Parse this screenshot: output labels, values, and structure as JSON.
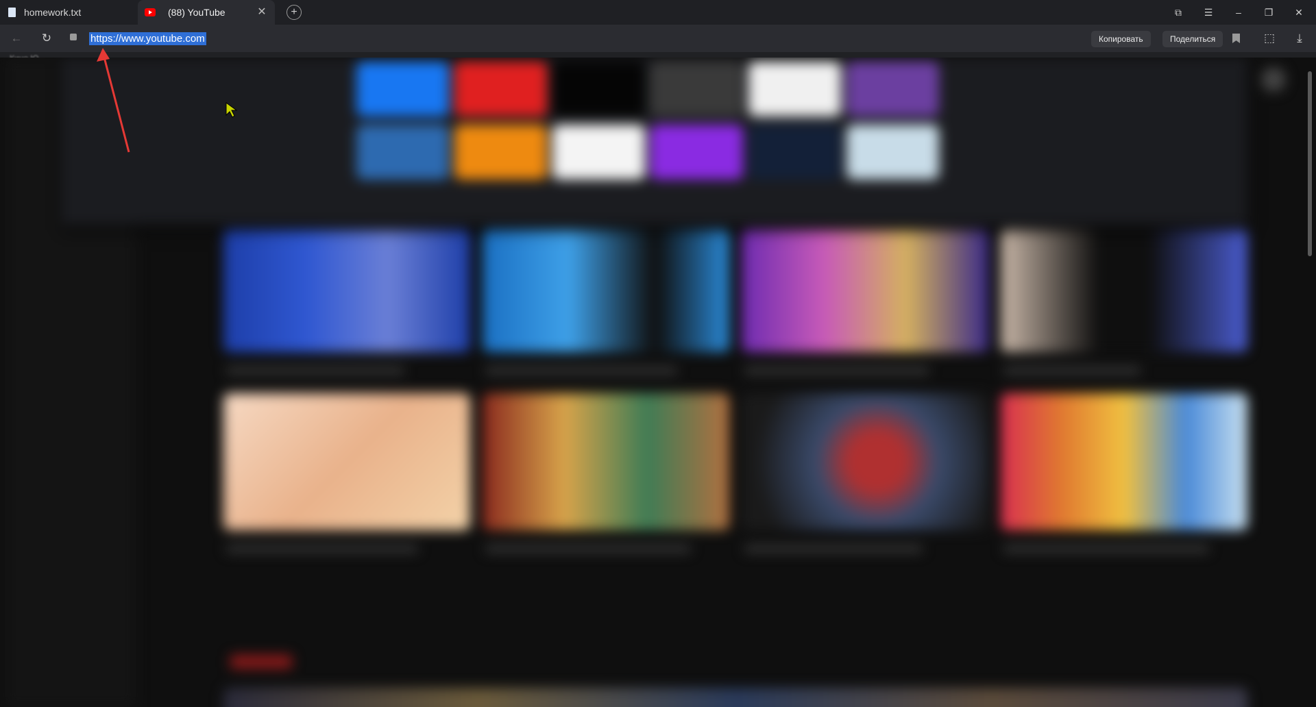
{
  "tabs": [
    {
      "title": "homework.txt",
      "icon": "document-icon"
    },
    {
      "title": "(88) YouTube",
      "icon": "youtube-icon",
      "active": true
    }
  ],
  "address_bar": {
    "url": "https://www.youtube.com",
    "copy_label": "Копировать",
    "share_label": "Поделиться"
  },
  "bookmarks_bar": {
    "item": "Кино Ю..."
  },
  "colors": {
    "selection": "#2f6fd6",
    "annotation_arrow": "#e53935",
    "cursor": "#c8d400"
  }
}
